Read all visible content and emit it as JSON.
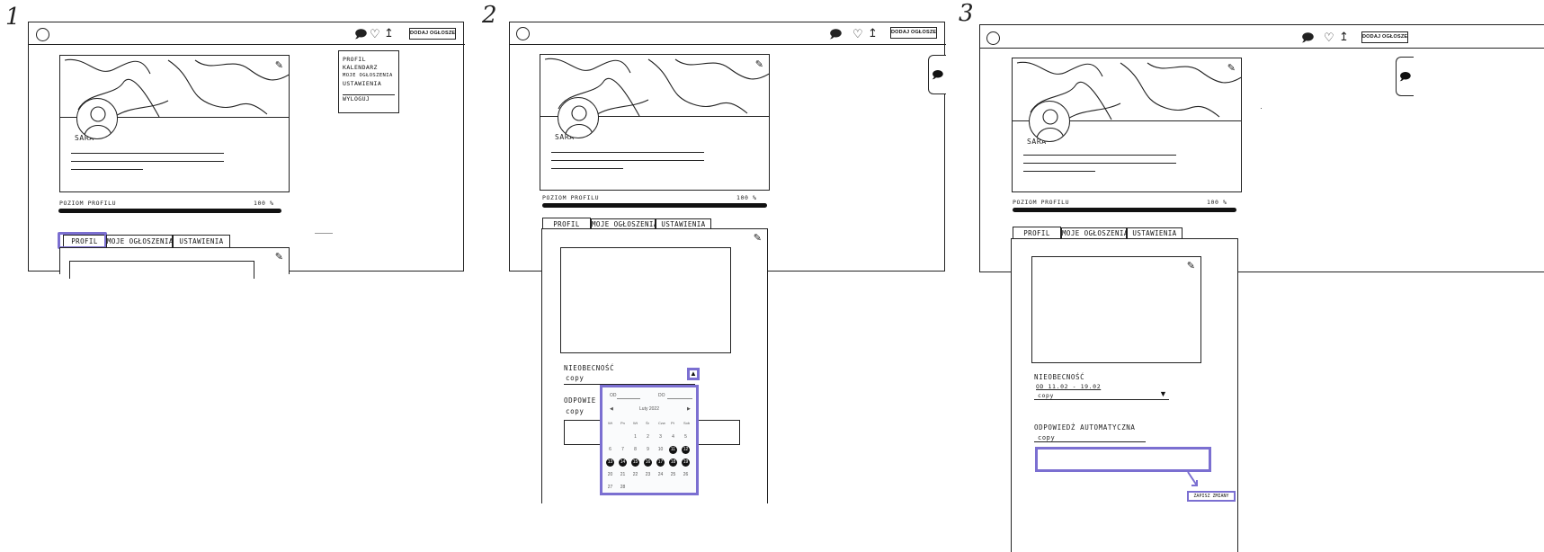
{
  "steps": [
    "1",
    "2",
    "3"
  ],
  "header": {
    "add_button_label": "DODAJ OGŁOSZENIE",
    "icons": [
      "chat-icon",
      "heart-icon",
      "user-icon"
    ]
  },
  "profile": {
    "name": "SARA",
    "level_label": "POZIOM PROFILU",
    "level_value": "100 %",
    "level_fraction": 1.0
  },
  "user_menu": {
    "items": [
      "PROFIL",
      "KALENDARZ",
      "MOJE OGŁOSZENIA",
      "USTAWIENIA"
    ],
    "logout": "WYLOGUJ"
  },
  "tabs": [
    "PROFIL",
    "MOJE OGŁOSZENIA",
    "USTAWIENIA"
  ],
  "absence": {
    "label": "NIEOBECNOŚĆ",
    "copy": "copy",
    "range": "OD 11.02 - 19.02"
  },
  "auto_reply": {
    "label": "ODPOWIEDŹ AUTOMATYCZNA",
    "label_truncated": "ODPOWIE",
    "copy": "copy"
  },
  "save_button": "ZAPISZ ZMIANY",
  "calendar": {
    "from_label": "OD",
    "to_label": "DO",
    "month": "Luty 2022",
    "weekdays": [
      "Wt",
      "Śr",
      "Cz",
      "Pt",
      "So",
      "Nd",
      "Pn"
    ],
    "weekdays_display": [
      "Wt",
      "Pn",
      "Wt",
      "Śr",
      "Czw",
      "Pt",
      "Sob"
    ],
    "weeks": [
      [
        "",
        "",
        "",
        "1",
        "2",
        "3",
        "4",
        "5"
      ],
      [
        "6",
        "7",
        "8",
        "9",
        "10",
        "11",
        "12"
      ],
      [
        "13",
        "14",
        "15",
        "16",
        "17",
        "18",
        "19"
      ],
      [
        "20",
        "21",
        "22",
        "23",
        "24",
        "25",
        "26"
      ],
      [
        "27",
        "28"
      ]
    ],
    "selected_days": [
      11,
      12,
      13,
      14,
      15,
      16,
      17,
      18,
      19
    ]
  },
  "colors": {
    "highlight": "#7b6fd1",
    "ink": "#222222",
    "bar": "#111111"
  }
}
